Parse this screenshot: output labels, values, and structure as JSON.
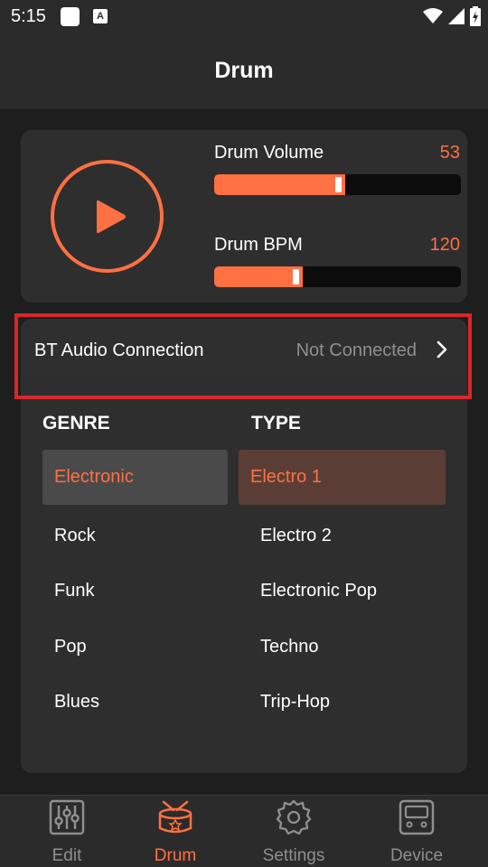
{
  "status_bar": {
    "time": "5:15"
  },
  "app_bar": {
    "title": "Drum"
  },
  "player": {
    "volume": {
      "label": "Drum Volume",
      "value": "53",
      "level": 0.53
    },
    "bpm": {
      "label": "Drum BPM",
      "value": "120",
      "level": 0.36
    }
  },
  "bt": {
    "label": "BT Audio Connection",
    "status": "Not Connected"
  },
  "lists": {
    "genre_header": "GENRE",
    "type_header": "TYPE",
    "genres": [
      "Electronic",
      "Rock",
      "Funk",
      "Pop",
      "Blues"
    ],
    "types": [
      "Electro 1",
      "Electro 2",
      "Electronic Pop",
      "Techno",
      "Trip-Hop"
    ],
    "selected_genre": "Electronic",
    "selected_type": "Electro 1"
  },
  "nav": {
    "items": [
      {
        "label": "Edit",
        "icon": "sliders-icon"
      },
      {
        "label": "Drum",
        "icon": "drum-icon"
      },
      {
        "label": "Settings",
        "icon": "gear-icon"
      },
      {
        "label": "Device",
        "icon": "device-icon"
      }
    ],
    "active": "Drum"
  },
  "colors": {
    "accent": "#ff7043",
    "highlight": "#d9262b",
    "background": "#1e1e1e",
    "card": "#2e2e2e"
  }
}
